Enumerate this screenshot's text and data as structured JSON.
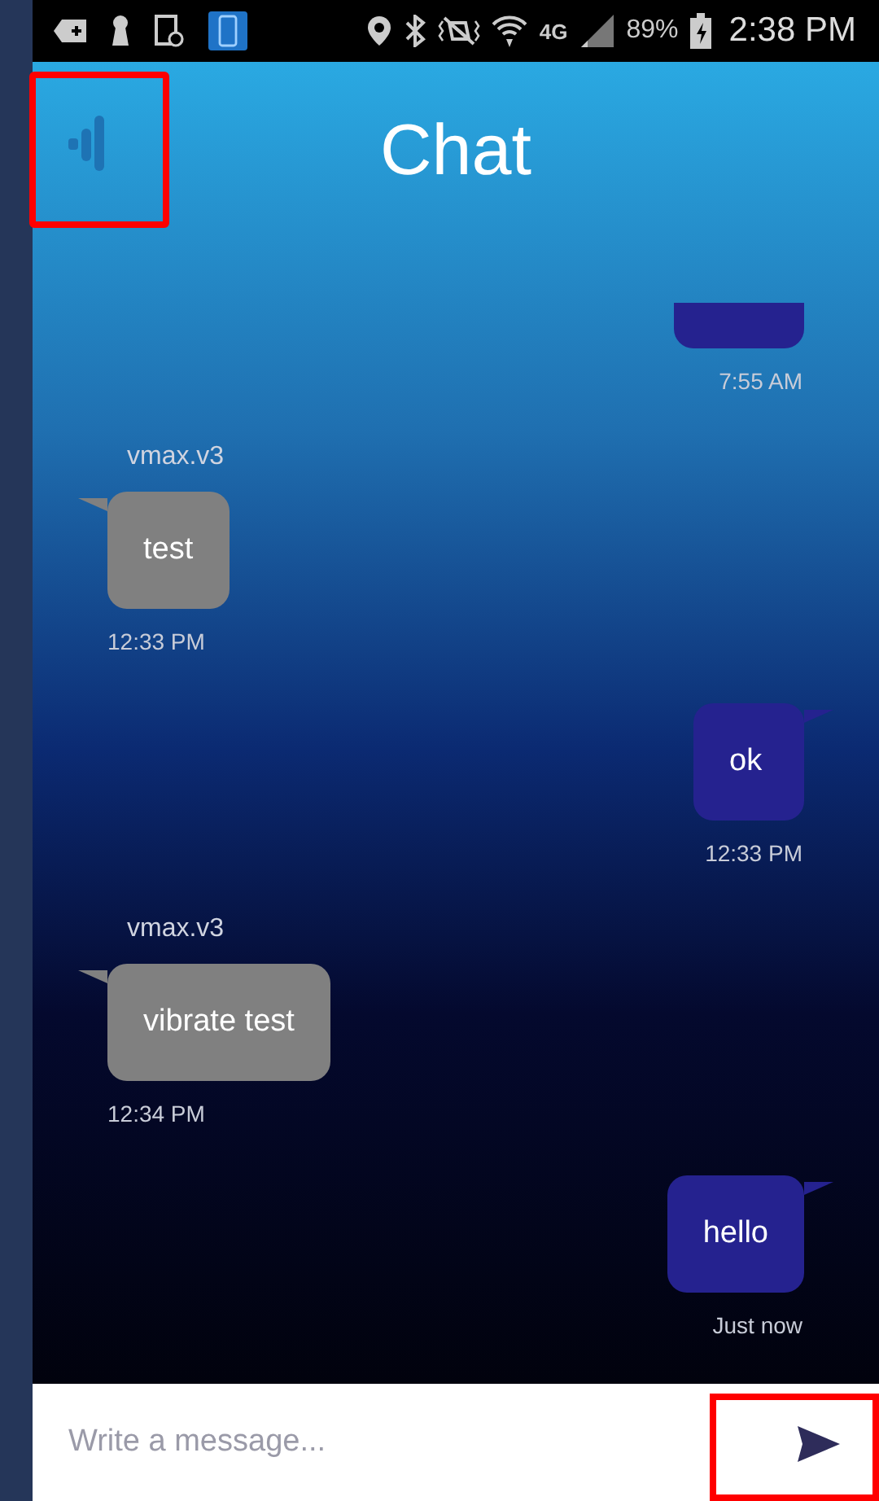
{
  "status_bar": {
    "network": "4G",
    "battery": "89%",
    "time": "2:38 PM"
  },
  "header": {
    "title": "Chat",
    "menu_highlighted": true
  },
  "messages": [
    {
      "kind": "outgoing",
      "clipped": true,
      "time": "7:55 AM"
    },
    {
      "kind": "incoming",
      "clipped": false,
      "sender": "vmax.v3",
      "text": "test",
      "time": "12:33 PM"
    },
    {
      "kind": "outgoing",
      "clipped": false,
      "text": "ok",
      "time": "12:33 PM"
    },
    {
      "kind": "incoming",
      "clipped": false,
      "sender": "vmax.v3",
      "text": "vibrate test",
      "time": "12:34 PM"
    },
    {
      "kind": "outgoing",
      "clipped": false,
      "text": "hello",
      "time": "Just now"
    }
  ],
  "composer": {
    "placeholder": "Write a message...",
    "send_highlighted": true
  }
}
